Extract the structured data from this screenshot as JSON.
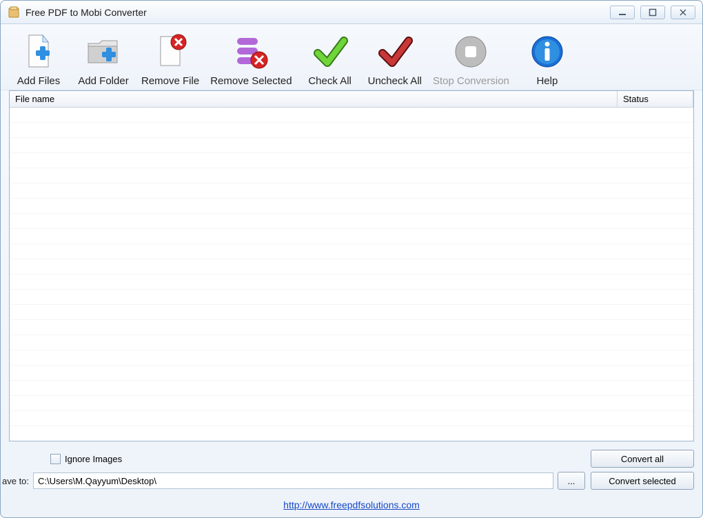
{
  "window": {
    "title": "Free PDF to Mobi Converter"
  },
  "toolbar": {
    "add_files": "Add Files",
    "add_folder": "Add Folder",
    "remove_file": "Remove File",
    "remove_selected": "Remove Selected",
    "check_all": "Check All",
    "uncheck_all": "Uncheck All",
    "stop_conversion": "Stop Conversion",
    "help": "Help"
  },
  "columns": {
    "filename": "File name",
    "status": "Status"
  },
  "options": {
    "ignore_images": "Ignore Images",
    "save_to_label": "ave to:",
    "save_to_path": "C:\\Users\\M.Qayyum\\Desktop\\",
    "browse": "..."
  },
  "actions": {
    "convert_all": "Convert all",
    "convert_selected": "Convert selected"
  },
  "footer": {
    "link_text": "http://www.freepdfsolutions.com",
    "link_href": "http://www.freepdfsolutions.com"
  }
}
